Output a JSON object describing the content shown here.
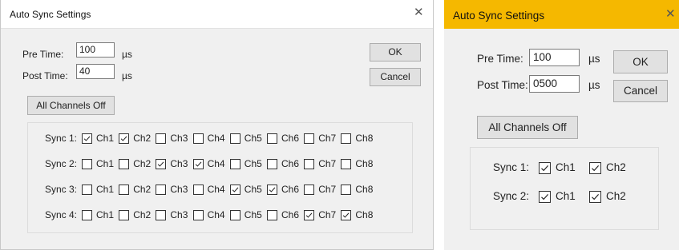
{
  "dialog1": {
    "title": "Auto Sync Settings",
    "pre_time_label": "Pre Time:",
    "pre_time_value": "100",
    "post_time_label": "Post Time:",
    "post_time_value": "40",
    "unit": "µs",
    "ok_label": "OK",
    "cancel_label": "Cancel",
    "all_channels_off_label": "All Channels Off",
    "sync_rows": [
      {
        "label": "Sync 1:",
        "channels": [
          {
            "label": "Ch1",
            "checked": true
          },
          {
            "label": "Ch2",
            "checked": true
          },
          {
            "label": "Ch3",
            "checked": false
          },
          {
            "label": "Ch4",
            "checked": false
          },
          {
            "label": "Ch5",
            "checked": false
          },
          {
            "label": "Ch6",
            "checked": false
          },
          {
            "label": "Ch7",
            "checked": false
          },
          {
            "label": "Ch8",
            "checked": false
          }
        ]
      },
      {
        "label": "Sync 2:",
        "channels": [
          {
            "label": "Ch1",
            "checked": false
          },
          {
            "label": "Ch2",
            "checked": false
          },
          {
            "label": "Ch3",
            "checked": true
          },
          {
            "label": "Ch4",
            "checked": true
          },
          {
            "label": "Ch5",
            "checked": false
          },
          {
            "label": "Ch6",
            "checked": false
          },
          {
            "label": "Ch7",
            "checked": false
          },
          {
            "label": "Ch8",
            "checked": false
          }
        ]
      },
      {
        "label": "Sync 3:",
        "channels": [
          {
            "label": "Ch1",
            "checked": false
          },
          {
            "label": "Ch2",
            "checked": false
          },
          {
            "label": "Ch3",
            "checked": false
          },
          {
            "label": "Ch4",
            "checked": false
          },
          {
            "label": "Ch5",
            "checked": true
          },
          {
            "label": "Ch6",
            "checked": true
          },
          {
            "label": "Ch7",
            "checked": false
          },
          {
            "label": "Ch8",
            "checked": false
          }
        ]
      },
      {
        "label": "Sync 4:",
        "channels": [
          {
            "label": "Ch1",
            "checked": false
          },
          {
            "label": "Ch2",
            "checked": false
          },
          {
            "label": "Ch3",
            "checked": false
          },
          {
            "label": "Ch4",
            "checked": false
          },
          {
            "label": "Ch5",
            "checked": false
          },
          {
            "label": "Ch6",
            "checked": false
          },
          {
            "label": "Ch7",
            "checked": true
          },
          {
            "label": "Ch8",
            "checked": true
          }
        ]
      }
    ]
  },
  "dialog2": {
    "title": "Auto Sync Settings",
    "pre_time_label": "Pre Time:",
    "pre_time_value": "100",
    "post_time_label": "Post Time:",
    "post_time_value": "0500",
    "unit": "µs",
    "ok_label": "OK",
    "cancel_label": "Cancel",
    "all_channels_off_label": "All Channels Off",
    "sync_rows": [
      {
        "label": "Sync 1:",
        "channels": [
          {
            "label": "Ch1",
            "checked": true
          },
          {
            "label": "Ch2",
            "checked": true
          }
        ]
      },
      {
        "label": "Sync 2:",
        "channels": [
          {
            "label": "Ch1",
            "checked": true
          },
          {
            "label": "Ch2",
            "checked": true
          }
        ]
      }
    ]
  },
  "colors": {
    "title_bar_accent": "#f5b800",
    "dialog_bg": "#f0f0f0",
    "button_bg": "#e1e1e1"
  },
  "icons": {
    "close": "close-icon",
    "check": "checkmark-icon"
  }
}
